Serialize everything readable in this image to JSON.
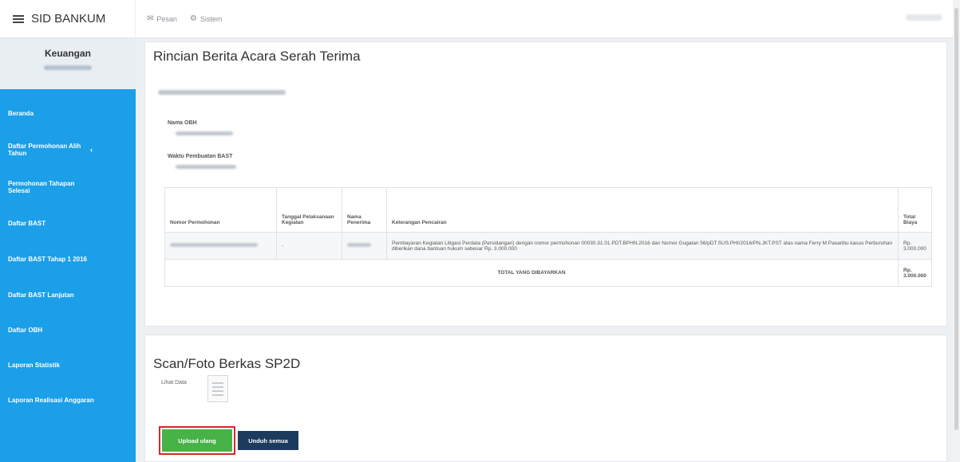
{
  "app": {
    "title": "SID BANKUM"
  },
  "topnav": {
    "items": [
      {
        "label": "Pesan",
        "icon": "mail-icon"
      },
      {
        "label": "Sistem",
        "icon": "gear-icon"
      }
    ]
  },
  "sidebar": {
    "role": "Keuangan",
    "items": [
      {
        "label": "Beranda"
      },
      {
        "label": "Daftar Permohonan Alih Tahun"
      },
      {
        "label": "Permohonan Tahapan Selesai"
      },
      {
        "label": "Daftar BAST"
      },
      {
        "label": "Daftar BAST Tahap 1 2016"
      },
      {
        "label": "Daftar BAST Lanjutan"
      },
      {
        "label": "Daftar OBH"
      },
      {
        "label": "Laporan Statistik"
      },
      {
        "label": "Laporan Realisasi Anggaran"
      }
    ]
  },
  "rincian": {
    "title": "Rincian Berita Acara Serah Terima",
    "fields": {
      "obh_label": "Nama OBH",
      "waktu_label": "Waktu Pembuatan BAST"
    },
    "table": {
      "headers": [
        "Nomor Permohonan",
        "Tanggal Pelaksanaan Kegiatan",
        "Nama Penerima",
        "Keterangan Pencairan",
        "Total Biaya"
      ],
      "row": {
        "tanggal": "-",
        "keterangan": "Pembayaran Kegiatan Litigasi Perdata (Persidangan) dengan nomor permohonan 00030.31.01.PDT.BPHN.2016 dan Nomor Gugatan 56/pDT.SUS.PHI/2016/PN.JKT.PST atas nama Ferry M Pasaribu kasus Perburuhan diberikan dana bantuan hukum sebesar Rp. 3.000.000",
        "total": "Rp. 3.000.000"
      },
      "total_label": "TOTAL YANG DIBAYARKAN",
      "total_value": "Rp. 3.000.000"
    }
  },
  "sp2d": {
    "title": "Scan/Foto Berkas SP2D",
    "lihat_label": "Lihat Data",
    "upload_label": "Upload ulang",
    "unduh_label": "Unduh semua"
  },
  "colors": {
    "sidebar": "#1b9fe8",
    "upload": "#47b347",
    "unduh": "#1c3b5f",
    "highlight": "#d8262c"
  }
}
